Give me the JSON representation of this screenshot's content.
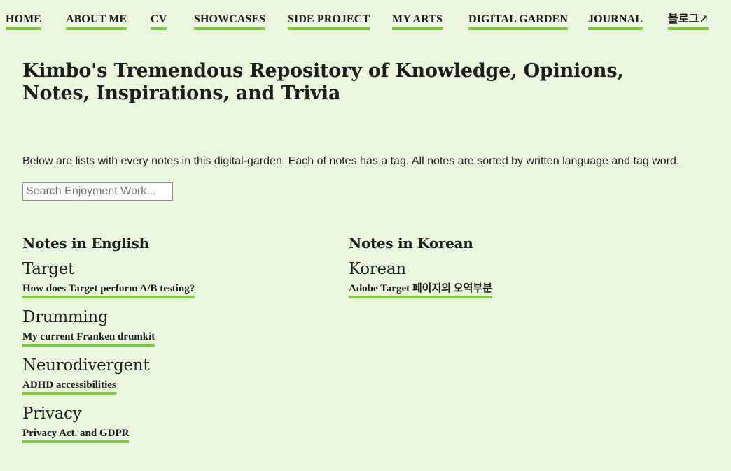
{
  "nav": {
    "items": [
      {
        "label": "HOME"
      },
      {
        "label": "ABOUT ME"
      },
      {
        "label": "CV"
      },
      {
        "label": "SHOWCASES"
      },
      {
        "label": "SIDE PROJECT"
      },
      {
        "label": "MY ARTS"
      },
      {
        "label": "DIGITAL GARDEN"
      },
      {
        "label": "JOURNAL"
      },
      {
        "label": "블로그↗"
      }
    ]
  },
  "page": {
    "title": "Kimbo's Tremendous Repository of Knowledge, Opinions, Notes, Inspirations, and Trivia",
    "intro": "Below are lists with every notes in this digital-garden. Each of notes has a tag. All notes are sorted by written language and tag word."
  },
  "search": {
    "placeholder": "Search Enjoyment Work...",
    "value": ""
  },
  "english": {
    "heading": "Notes in English",
    "tags": [
      {
        "tag": "Target",
        "notes": [
          "How does Target perform A/B testing?"
        ]
      },
      {
        "tag": "Drumming",
        "notes": [
          "My current Franken drumkit"
        ]
      },
      {
        "tag": "Neurodivergent",
        "notes": [
          "ADHD accessibilities"
        ]
      },
      {
        "tag": "Privacy",
        "notes": [
          "Privacy Act. and GDPR"
        ]
      }
    ]
  },
  "korean": {
    "heading": "Notes in Korean",
    "tags": [
      {
        "tag": "Korean",
        "notes": [
          "Adobe Target 페이지의 오역부분"
        ]
      }
    ]
  },
  "colors": {
    "background": "#ebf6df",
    "accent": "#7acc3a",
    "text": "#1d1d1d"
  }
}
